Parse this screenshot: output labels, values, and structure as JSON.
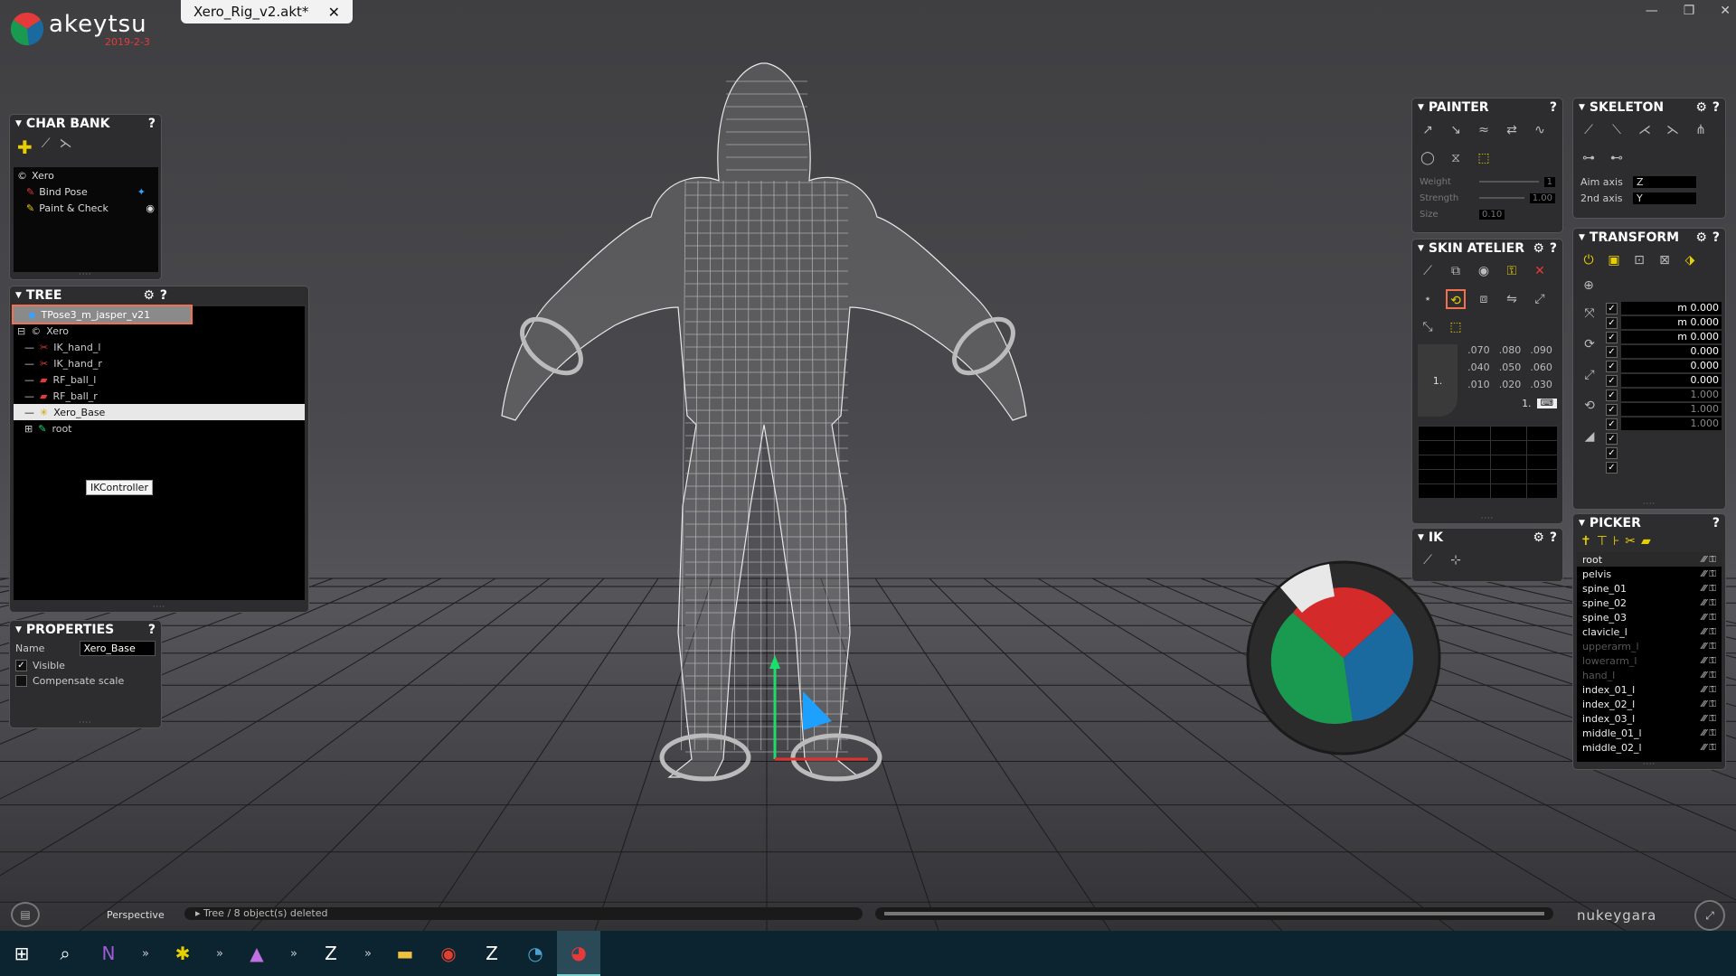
{
  "app": {
    "name": "akeytsu",
    "version": "2019-2-3",
    "brand_colors": {
      "red": "#e53a3a",
      "green": "#1a9a50",
      "blue": "#1a6aa0"
    }
  },
  "tab": {
    "title": "Xero_Rig_v2.akt*",
    "close": "✕"
  },
  "window_controls": {
    "minimize": "—",
    "restore": "❐",
    "close": "✕"
  },
  "charbank": {
    "title": "CHAR BANK",
    "help": "?",
    "items": [
      {
        "label": "Xero",
        "icon": "character-icon"
      },
      {
        "label": "Bind Pose",
        "icon": "bind-pose-icon"
      },
      {
        "label": "Paint & Check",
        "icon": "paint-icon",
        "visible_icon": "eye-icon"
      }
    ]
  },
  "tree": {
    "title": "TREE",
    "help": "?",
    "settings": "⚙",
    "tooltip": "IKController",
    "items": [
      {
        "label": "TPose3_m_jasper_v21",
        "indent": 0,
        "state": "first"
      },
      {
        "label": "Xero",
        "indent": 0
      },
      {
        "label": "IK_hand_l",
        "indent": 1
      },
      {
        "label": "IK_hand_r",
        "indent": 1
      },
      {
        "label": "RF_ball_l",
        "indent": 1
      },
      {
        "label": "RF_ball_r",
        "indent": 1
      },
      {
        "label": "Xero_Base",
        "indent": 1,
        "state": "sel"
      },
      {
        "label": "root",
        "indent": 1
      }
    ]
  },
  "properties": {
    "title": "PROPERTIES",
    "help": "?",
    "name_label": "Name",
    "name_value": "Xero_Base",
    "visible_label": "Visible",
    "visible_checked": true,
    "compensate_label": "Compensate scale",
    "compensate_checked": false
  },
  "painter": {
    "title": "PAINTER",
    "help": "?",
    "weight_label": "Weight",
    "weight_value": "1",
    "strength_label": "Strength",
    "strength_value": "1.00",
    "size_label": "Size",
    "size_value": "0.10"
  },
  "skeleton": {
    "title": "SKELETON",
    "help": "?",
    "settings": "⚙",
    "aim_axis_label": "Aim axis",
    "aim_axis_value": "Z",
    "second_axis_label": "2nd axis",
    "second_axis_value": "Y"
  },
  "skin_atelier": {
    "title": "SKIN ATELIER",
    "help": "?",
    "settings": "⚙",
    "numbers": [
      ".070",
      ".080",
      ".090",
      ".040",
      ".050",
      ".060",
      ".010",
      ".020",
      ".030"
    ],
    "left_value": "1.",
    "right_value": "1."
  },
  "transform": {
    "title": "TRANSFORM",
    "help": "?",
    "settings": "⚙",
    "values": [
      "m 0.000",
      "m 0.000",
      "m 0.000",
      "0.000",
      "0.000",
      "0.000",
      "1.000",
      "1.000",
      "1.000"
    ]
  },
  "ik": {
    "title": "IK",
    "help": "?",
    "settings": "⚙"
  },
  "picker": {
    "title": "PICKER",
    "help": "?",
    "items": [
      "root",
      "pelvis",
      "spine_01",
      "spine_02",
      "spine_03",
      "clavicle_l",
      "upperarm_l",
      "lowerarm_l",
      "hand_l",
      "index_01_l",
      "index_02_l",
      "index_03_l",
      "middle_01_l",
      "middle_02_l"
    ],
    "dim_items": [
      "upperarm_l",
      "lowerarm_l",
      "hand_l"
    ]
  },
  "status": {
    "view": "Perspective",
    "message": "Tree / 8 object(s) deleted",
    "brand": "nukeygara"
  }
}
